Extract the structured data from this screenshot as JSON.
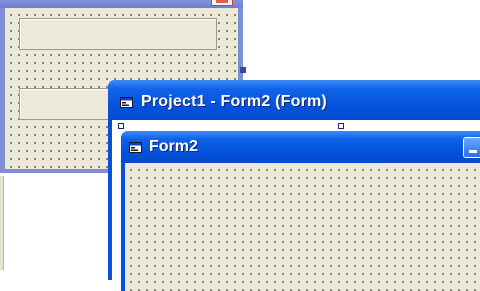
{
  "back_window": {
    "name": "form1-designer"
  },
  "front_window": {
    "title": "Project1 - Form2 (Form)",
    "icon": "form-icon"
  },
  "inner_form": {
    "title": "Form2",
    "icon": "form-icon",
    "buttons": [
      "minimize-button"
    ]
  },
  "colors": {
    "titlebar_blue": "#0551dc",
    "form_background": "#ece9d8",
    "back_window_border": "#7f8fd6"
  }
}
